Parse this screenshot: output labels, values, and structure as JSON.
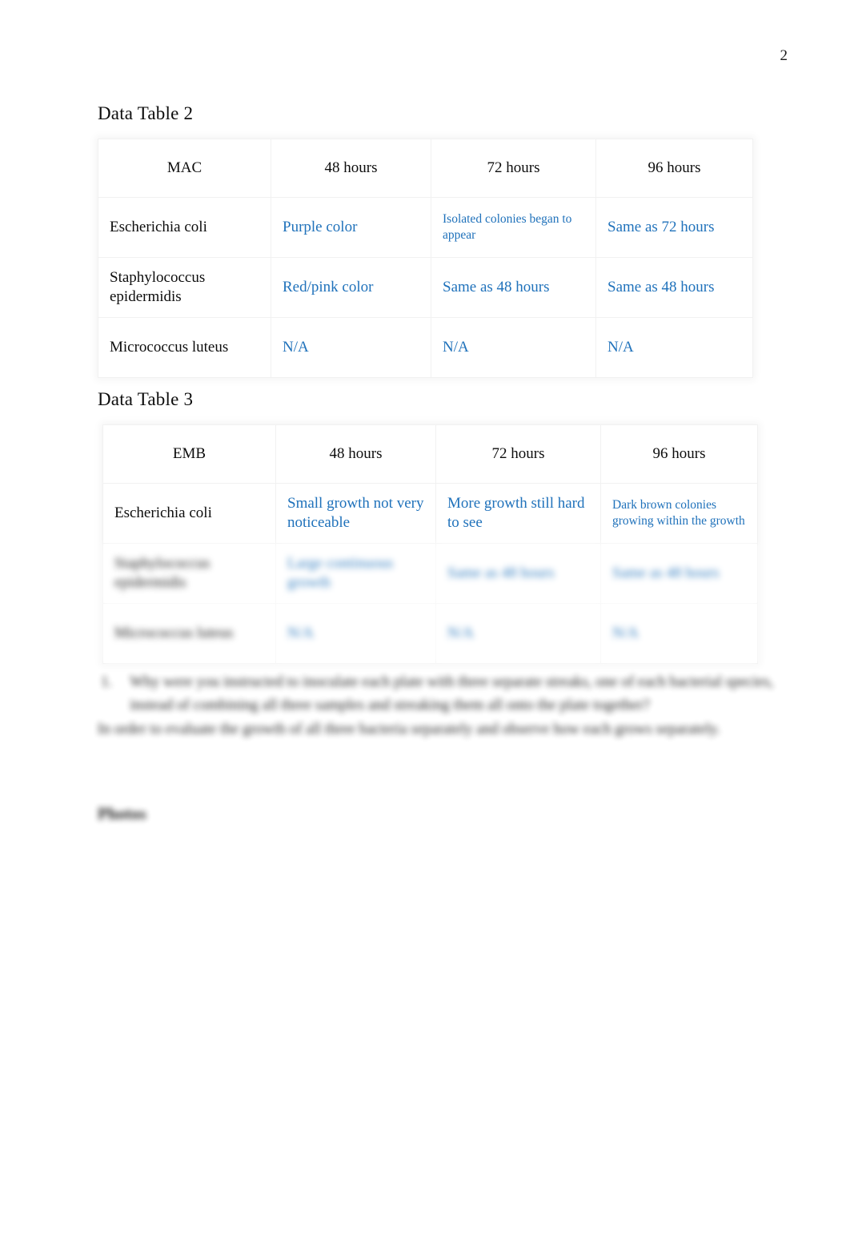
{
  "page": {
    "number": "2"
  },
  "sections": [
    {
      "title": "Data Table 2",
      "table": {
        "headers": [
          "MAC",
          "48 hours",
          "72 hours",
          "96 hours"
        ],
        "rows": [
          {
            "organism": "Escherichia coli",
            "h48": "Purple color",
            "h72": "Isolated colonies began to appear",
            "h96": "Same as 72 hours",
            "h48_small": false,
            "h72_small": true,
            "h96_small": false,
            "redacted": false
          },
          {
            "organism": "Staphylococcus epidermidis",
            "h48": "Red/pink color",
            "h72": "Same as 48 hours",
            "h96": "Same as 48 hours",
            "h48_small": false,
            "h72_small": false,
            "h96_small": false,
            "redacted": false
          },
          {
            "organism": "Micrococcus luteus",
            "h48": "N/A",
            "h72": "N/A",
            "h96": "N/A",
            "h48_small": false,
            "h72_small": false,
            "h96_small": false,
            "redacted": false
          }
        ]
      }
    },
    {
      "title": "Data Table 3",
      "table": {
        "headers": [
          "EMB",
          "48 hours",
          "72 hours",
          "96 hours"
        ],
        "rows": [
          {
            "organism": "Escherichia coli",
            "h48": "Small growth not very noticeable",
            "h72": "More growth still hard to see",
            "h96": "Dark brown colonies growing within the growth",
            "h48_small": false,
            "h72_small": false,
            "h96_small": true,
            "redacted": false
          },
          {
            "organism": "Staphylococcus epidermidis",
            "h48": "Large continuous growth",
            "h72": "Same as 48 hours",
            "h96": "Same as 48 hours",
            "h48_small": false,
            "h72_small": false,
            "h96_small": false,
            "redacted": true
          },
          {
            "organism": "Micrococcus luteus",
            "h48": "N/A",
            "h72": "N/A",
            "h96": "N/A",
            "h48_small": false,
            "h72_small": false,
            "h96_small": false,
            "redacted": true
          }
        ]
      }
    }
  ],
  "body": {
    "question_marker": "1.",
    "question_text": "Why were you instructed to inoculate each plate with three separate streaks, one of each bacterial species, instead of combining all three samples and streaking them all onto the plate together?",
    "answer_text": "In order to evaluate the growth of all three bacteria separately and observe how each grows separately."
  },
  "sub_heading": "Photos",
  "colors": {
    "observation_blue": "#2072bb",
    "text_black": "#0d0d0d",
    "table_border": "#f1f1f1"
  }
}
